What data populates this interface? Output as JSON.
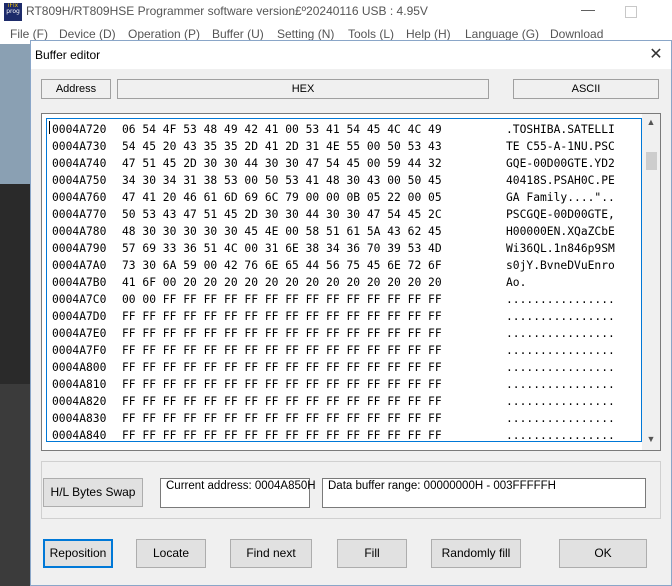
{
  "app": {
    "logo_line1": "iFlx",
    "logo_line2": "prog",
    "title": "RT809H/RT809HSE Programmer software version£º20240116  USB : 4.95V",
    "minimize_glyph": "—",
    "menu": [
      "File (F)",
      "Device (D)",
      "Operation (P)",
      "Buffer (U)",
      "Setting (N)",
      "Tools (L)",
      "Help (H)",
      "Language (G)",
      "Download"
    ]
  },
  "dialog": {
    "title": "Buffer editor",
    "close_glyph": "✕",
    "headers": {
      "address": "Address",
      "hex": "HEX",
      "ascii": "ASCII"
    },
    "rows": [
      {
        "addr": "0004A720",
        "hex": "06 54 4F 53 48 49 42 41 00 53 41 54 45 4C 4C 49",
        "ascii": ".TOSHIBA.SATELLI"
      },
      {
        "addr": "0004A730",
        "hex": "54 45 20 43 35 35 2D 41 2D 31 4E 55 00 50 53 43",
        "ascii": "TE C55-A-1NU.PSC"
      },
      {
        "addr": "0004A740",
        "hex": "47 51 45 2D 30 30 44 30 30 47 54 45 00 59 44 32",
        "ascii": "GQE-00D00GTE.YD2"
      },
      {
        "addr": "0004A750",
        "hex": "34 30 34 31 38 53 00 50 53 41 48 30 43 00 50 45",
        "ascii": "40418S.PSAH0C.PE"
      },
      {
        "addr": "0004A760",
        "hex": "47 41 20 46 61 6D 69 6C 79 00 00 0B 05 22 00 05",
        "ascii": "GA Family....\".."
      },
      {
        "addr": "0004A770",
        "hex": "50 53 43 47 51 45 2D 30 30 44 30 30 47 54 45 2C",
        "ascii": "PSCGQE-00D00GTE,"
      },
      {
        "addr": "0004A780",
        "hex": "48 30 30 30 30 30 45 4E 00 58 51 61 5A 43 62 45",
        "ascii": "H00000EN.XQaZCbE"
      },
      {
        "addr": "0004A790",
        "hex": "57 69 33 36 51 4C 00 31 6E 38 34 36 70 39 53 4D",
        "ascii": "Wi36QL.1n846p9SM"
      },
      {
        "addr": "0004A7A0",
        "hex": "73 30 6A 59 00 42 76 6E 65 44 56 75 45 6E 72 6F",
        "ascii": "s0jY.BvneDVuEnro"
      },
      {
        "addr": "0004A7B0",
        "hex": "41 6F 00 20 20 20 20 20 20 20 20 20 20 20 20 20",
        "ascii": "Ao.             "
      },
      {
        "addr": "0004A7C0",
        "hex": "00 00 FF FF FF FF FF FF FF FF FF FF FF FF FF FF",
        "ascii": "................"
      },
      {
        "addr": "0004A7D0",
        "hex": "FF FF FF FF FF FF FF FF FF FF FF FF FF FF FF FF",
        "ascii": "................"
      },
      {
        "addr": "0004A7E0",
        "hex": "FF FF FF FF FF FF FF FF FF FF FF FF FF FF FF FF",
        "ascii": "................"
      },
      {
        "addr": "0004A7F0",
        "hex": "FF FF FF FF FF FF FF FF FF FF FF FF FF FF FF FF",
        "ascii": "................"
      },
      {
        "addr": "0004A800",
        "hex": "FF FF FF FF FF FF FF FF FF FF FF FF FF FF FF FF",
        "ascii": "................"
      },
      {
        "addr": "0004A810",
        "hex": "FF FF FF FF FF FF FF FF FF FF FF FF FF FF FF FF",
        "ascii": "................"
      },
      {
        "addr": "0004A820",
        "hex": "FF FF FF FF FF FF FF FF FF FF FF FF FF FF FF FF",
        "ascii": "................"
      },
      {
        "addr": "0004A830",
        "hex": "FF FF FF FF FF FF FF FF FF FF FF FF FF FF FF FF",
        "ascii": "................"
      },
      {
        "addr": "0004A840",
        "hex": "FF FF FF FF FF FF FF FF FF FF FF FF FF FF FF FF",
        "ascii": "................"
      }
    ],
    "scroll_up_glyph": "▲",
    "scroll_down_glyph": "▼",
    "swap_label": "H/L Bytes Swap",
    "current_address": "Current address: 0004A850H",
    "data_range": "Data buffer range: 00000000H - 003FFFFFH",
    "buttons": {
      "reposition": "Reposition",
      "locate": "Locate",
      "find_next": "Find next",
      "fill": "Fill",
      "randomly_fill": "Randomly fill",
      "ok": "OK"
    },
    "accent_color": "#0078d7"
  }
}
